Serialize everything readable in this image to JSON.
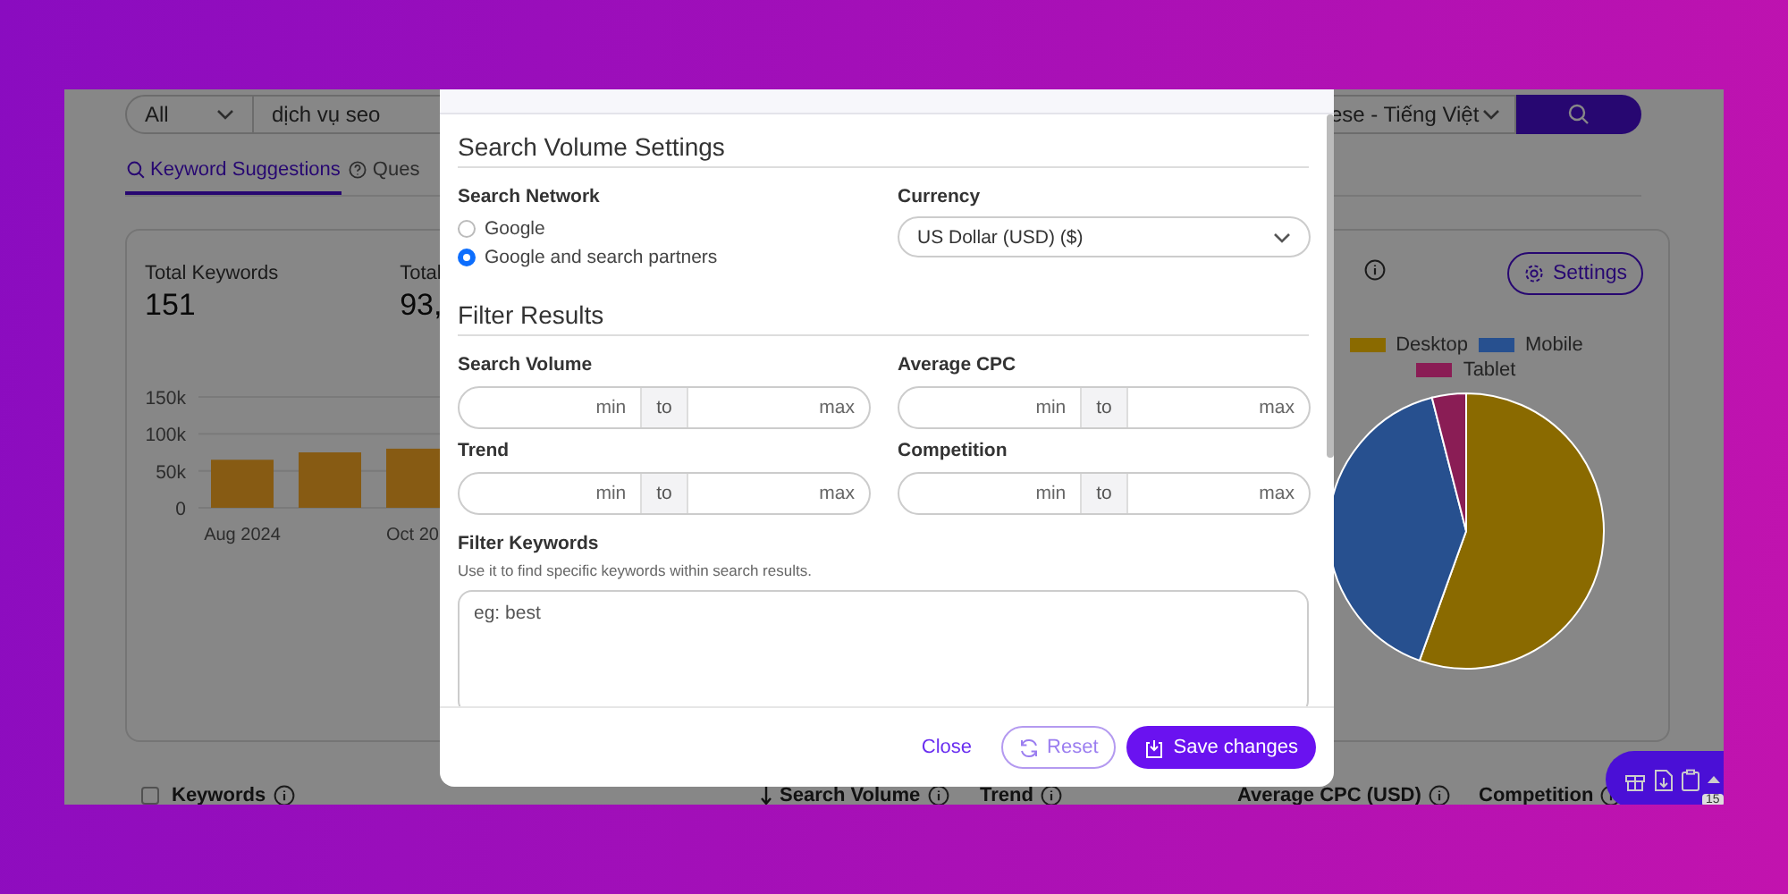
{
  "search_bar": {
    "scope": "All",
    "query": "dịch vụ seo",
    "language": "ese - Tiếng Việt"
  },
  "tabs": [
    {
      "label": "Keyword Suggestions",
      "selected": true
    },
    {
      "label": "Ques",
      "selected": false
    }
  ],
  "stats": [
    {
      "label": "Total Keywords",
      "value": "151"
    },
    {
      "label": "Total",
      "value": "93,"
    }
  ],
  "volume_chart": {
    "chart_data": {
      "type": "bar",
      "values": [
        65000,
        75000,
        80000
      ],
      "color": "#875b13",
      "categories": [
        "Aug 2024",
        null,
        "Oct 20"
      ],
      "ylim": [
        0,
        150000
      ],
      "yticks": [
        {
          "value": 0,
          "label": "0"
        },
        {
          "value": 50000,
          "label": "50k"
        },
        {
          "value": 100000,
          "label": "100k"
        },
        {
          "value": 150000,
          "label": "150k"
        }
      ]
    }
  },
  "device_panel": {
    "settings_button": "Settings",
    "legend": [
      {
        "label": "Desktop",
        "color": "#8a6a00"
      },
      {
        "label": "Mobile",
        "color": "#27508f"
      },
      {
        "label": "Tablet",
        "color": "#8a1d55"
      }
    ]
  },
  "table": {
    "select_all": {
      "checked": false
    },
    "columns": [
      {
        "label": "Keywords",
        "sorted": false
      },
      {
        "label": "Search Volume",
        "sorted": true
      },
      {
        "label": "Trend",
        "sorted": false
      },
      {
        "label": "Average CPC (USD)",
        "sorted": false
      },
      {
        "label": "Competition",
        "sorted": false
      }
    ]
  },
  "toolbar": {
    "badge": "15"
  },
  "modal": {
    "sections": [
      {
        "title": "Search Volume Settings"
      },
      {
        "title": "Filter Results"
      }
    ],
    "network": {
      "label": "Search Network",
      "options": [
        {
          "label": "Google",
          "selected": false
        },
        {
          "label": "Google and search partners",
          "selected": true
        }
      ]
    },
    "currency": {
      "label": "Currency",
      "value": "US Dollar (USD) ($)"
    },
    "ranges": [
      {
        "label": "Search Volume",
        "min": {
          "placeholder": "min"
        },
        "separator": "to",
        "max": {
          "placeholder": "max"
        }
      },
      {
        "label": "Average CPC",
        "min": {
          "placeholder": "min"
        },
        "separator": "to",
        "max": {
          "placeholder": "max"
        }
      },
      {
        "label": "Trend",
        "min": {
          "placeholder": "min"
        },
        "separator": "to",
        "max": {
          "placeholder": "max"
        }
      },
      {
        "label": "Competition",
        "min": {
          "placeholder": "min"
        },
        "separator": "to",
        "max": {
          "placeholder": "max"
        }
      }
    ],
    "filter_keywords": {
      "label": "Filter Keywords",
      "help": "Use it to find specific keywords within search results.",
      "placeholder": "eg: best"
    },
    "buttons": {
      "close": "Close",
      "reset": "Reset",
      "save": "Save changes"
    }
  }
}
